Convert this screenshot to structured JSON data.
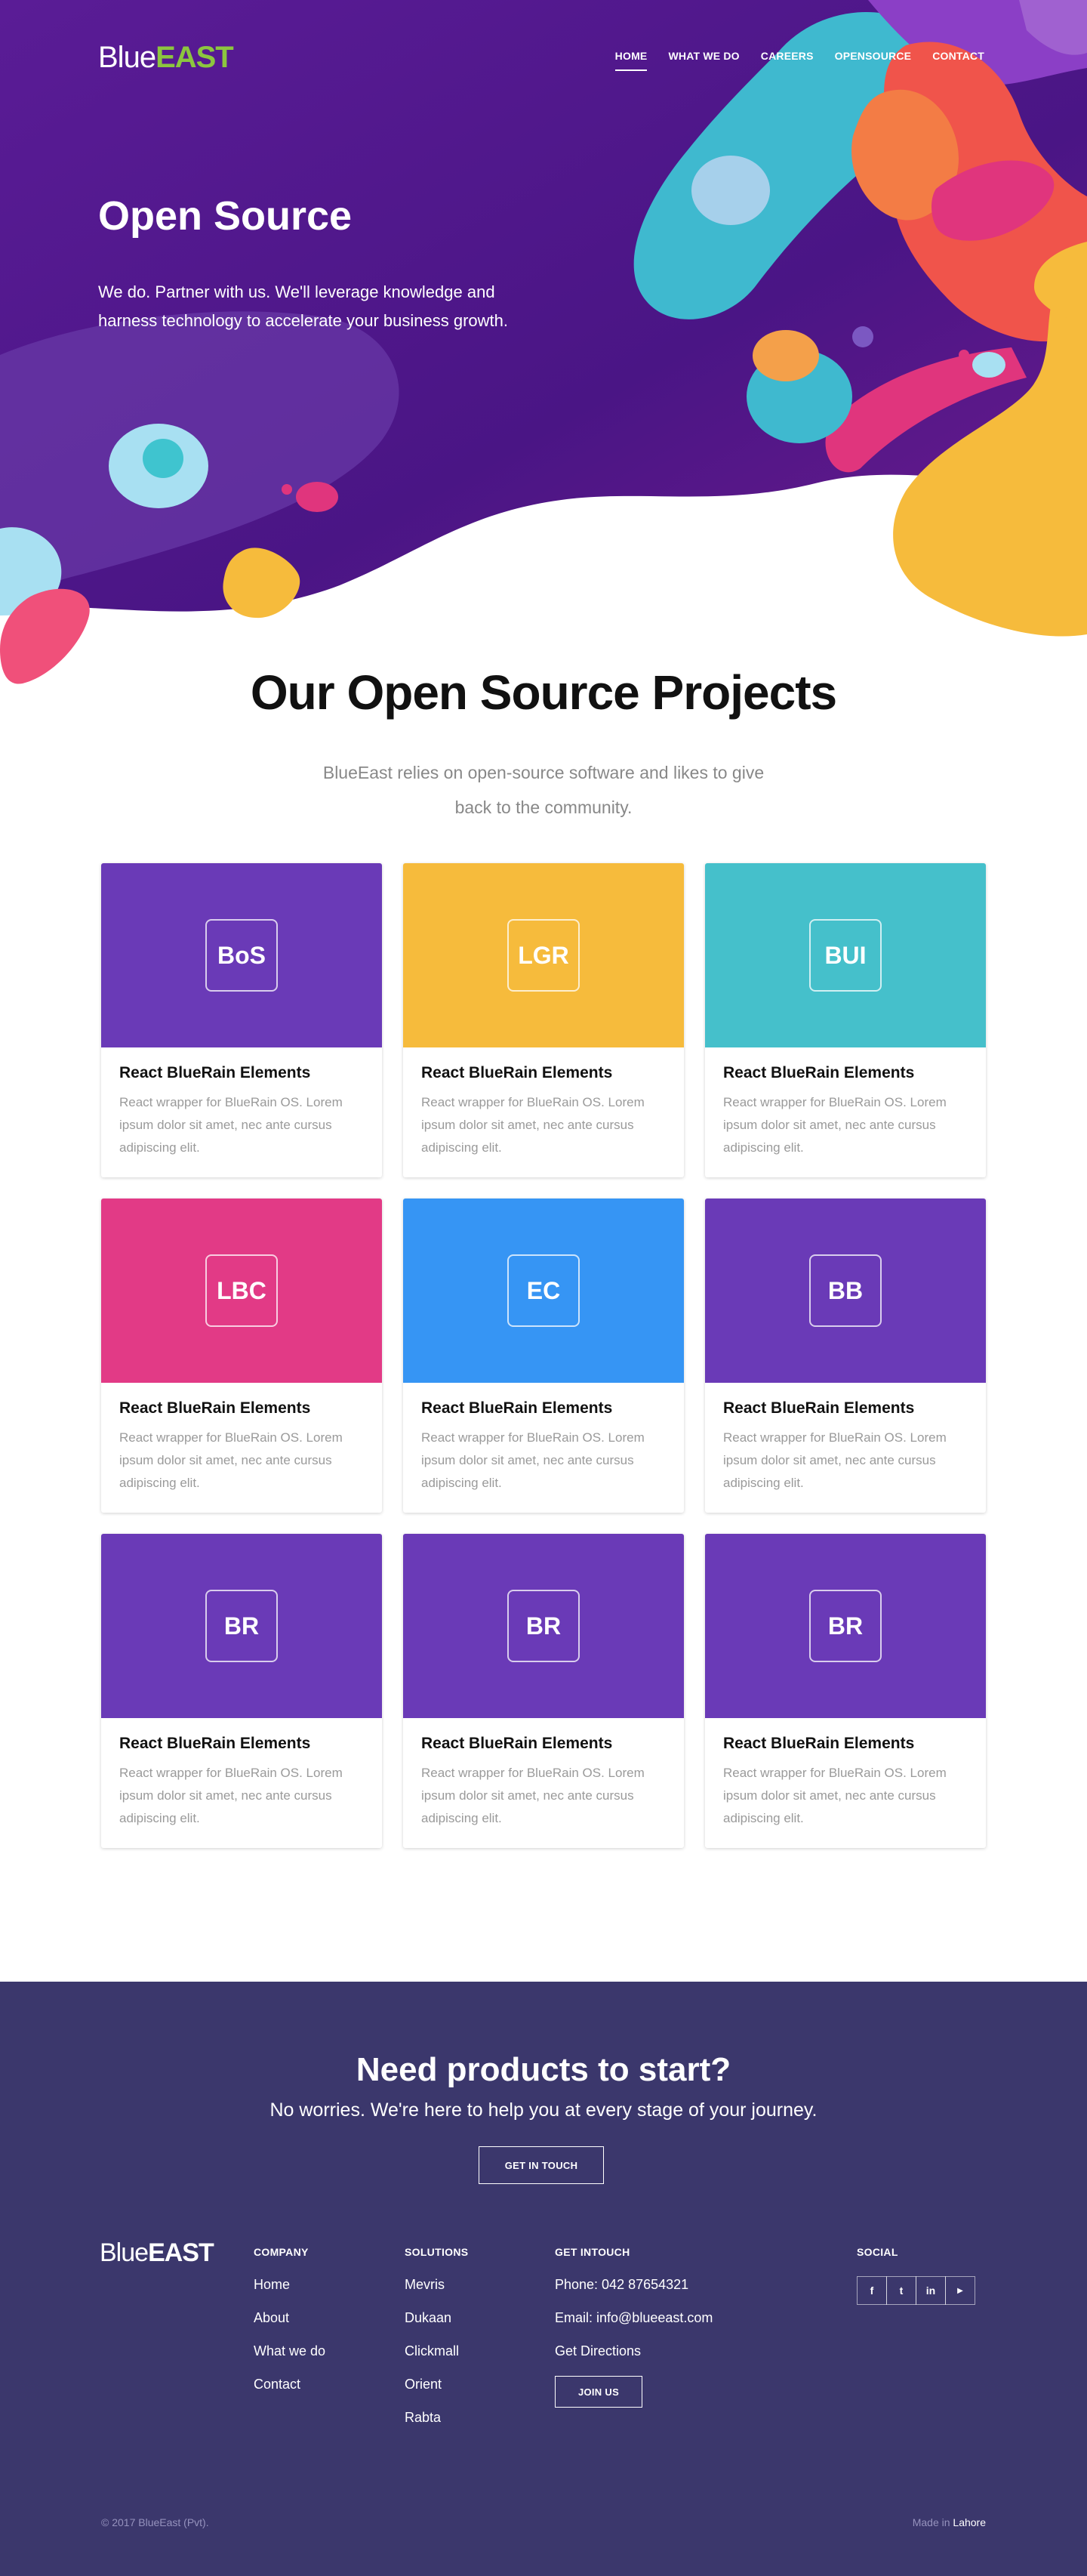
{
  "brand": {
    "part1": "Blue",
    "part2": "EAST"
  },
  "nav": {
    "items": [
      "HOME",
      "WHAT WE DO",
      "CAREERS",
      "OPENSOURCE",
      "CONTACT"
    ],
    "active": "HOME"
  },
  "hero": {
    "title": "Open Source",
    "subtitle": "We do. Partner with us. We'll leverage knowledge and harness technology to accelerate your business growth."
  },
  "projects": {
    "title": "Our Open Source Projects",
    "subtitle": "BlueEast relies on open-source software and likes to give back to the community.",
    "cards": [
      {
        "abbr": "BoS",
        "color": "#6a3ab7",
        "title": "React BlueRain Elements",
        "desc": "React wrapper for BlueRain OS. Lorem ipsum dolor sit amet, nec ante cursus adipiscing elit."
      },
      {
        "abbr": "LGR",
        "color": "#f6bb3c",
        "title": "React BlueRain Elements",
        "desc": "React wrapper for BlueRain OS. Lorem ipsum dolor sit amet, nec ante cursus adipiscing elit."
      },
      {
        "abbr": "BUI",
        "color": "#45c0cb",
        "title": "React BlueRain Elements",
        "desc": "React wrapper for BlueRain OS. Lorem ipsum dolor sit amet, nec ante cursus adipiscing elit."
      },
      {
        "abbr": "LBC",
        "color": "#e23a86",
        "title": "React BlueRain Elements",
        "desc": "React wrapper for BlueRain OS. Lorem ipsum dolor sit amet, nec ante cursus adipiscing elit."
      },
      {
        "abbr": "EC",
        "color": "#3695f4",
        "title": "React BlueRain Elements",
        "desc": "React wrapper for BlueRain OS. Lorem ipsum dolor sit amet, nec ante cursus adipiscing elit."
      },
      {
        "abbr": "BB",
        "color": "#6a3ab7",
        "title": "React BlueRain Elements",
        "desc": "React wrapper for BlueRain OS. Lorem ipsum dolor sit amet, nec ante cursus adipiscing elit."
      },
      {
        "abbr": "BR",
        "color": "#6a3ab7",
        "title": "React BlueRain Elements",
        "desc": "React wrapper for BlueRain OS. Lorem ipsum dolor sit amet, nec ante cursus adipiscing elit."
      },
      {
        "abbr": "BR",
        "color": "#6a3ab7",
        "title": "React BlueRain Elements",
        "desc": "React wrapper for BlueRain OS. Lorem ipsum dolor sit amet, nec ante cursus adipiscing elit."
      },
      {
        "abbr": "BR",
        "color": "#6a3ab7",
        "title": "React BlueRain Elements",
        "desc": "React wrapper for BlueRain OS. Lorem ipsum dolor sit amet, nec ante cursus adipiscing elit."
      }
    ]
  },
  "cta": {
    "title": "Need products to start?",
    "subtitle": "No worries. We're here to help you at every stage of your journey.",
    "button": "GET IN TOUCH"
  },
  "footer": {
    "company": {
      "heading": "COMPANY",
      "links": [
        "Home",
        "About",
        "What we do",
        "Contact"
      ]
    },
    "solutions": {
      "heading": "SOLUTIONS",
      "links": [
        "Mevris",
        "Dukaan",
        "Clickmall",
        "Orient",
        "Rabta"
      ]
    },
    "contact": {
      "heading": "GET INTOUCH",
      "phone": "Phone: 042 87654321",
      "email": "Email: info@blueeast.com",
      "directions": "Get Directions",
      "join": "JOIN US"
    },
    "social": {
      "heading": "SOCIAL",
      "icons": [
        "facebook-icon",
        "twitter-icon",
        "linkedin-icon",
        "youtube-icon"
      ],
      "glyphs": [
        "f",
        "t",
        "in",
        "▶"
      ]
    },
    "copyright": "© 2017 BlueEast (Pvt).",
    "made_prefix": "Made in",
    "made_city": "Lahore"
  },
  "colors": {
    "hero_bg": "#4e1a8c",
    "footer_bg": "#3b376c",
    "brand_green": "#8cc63f"
  }
}
